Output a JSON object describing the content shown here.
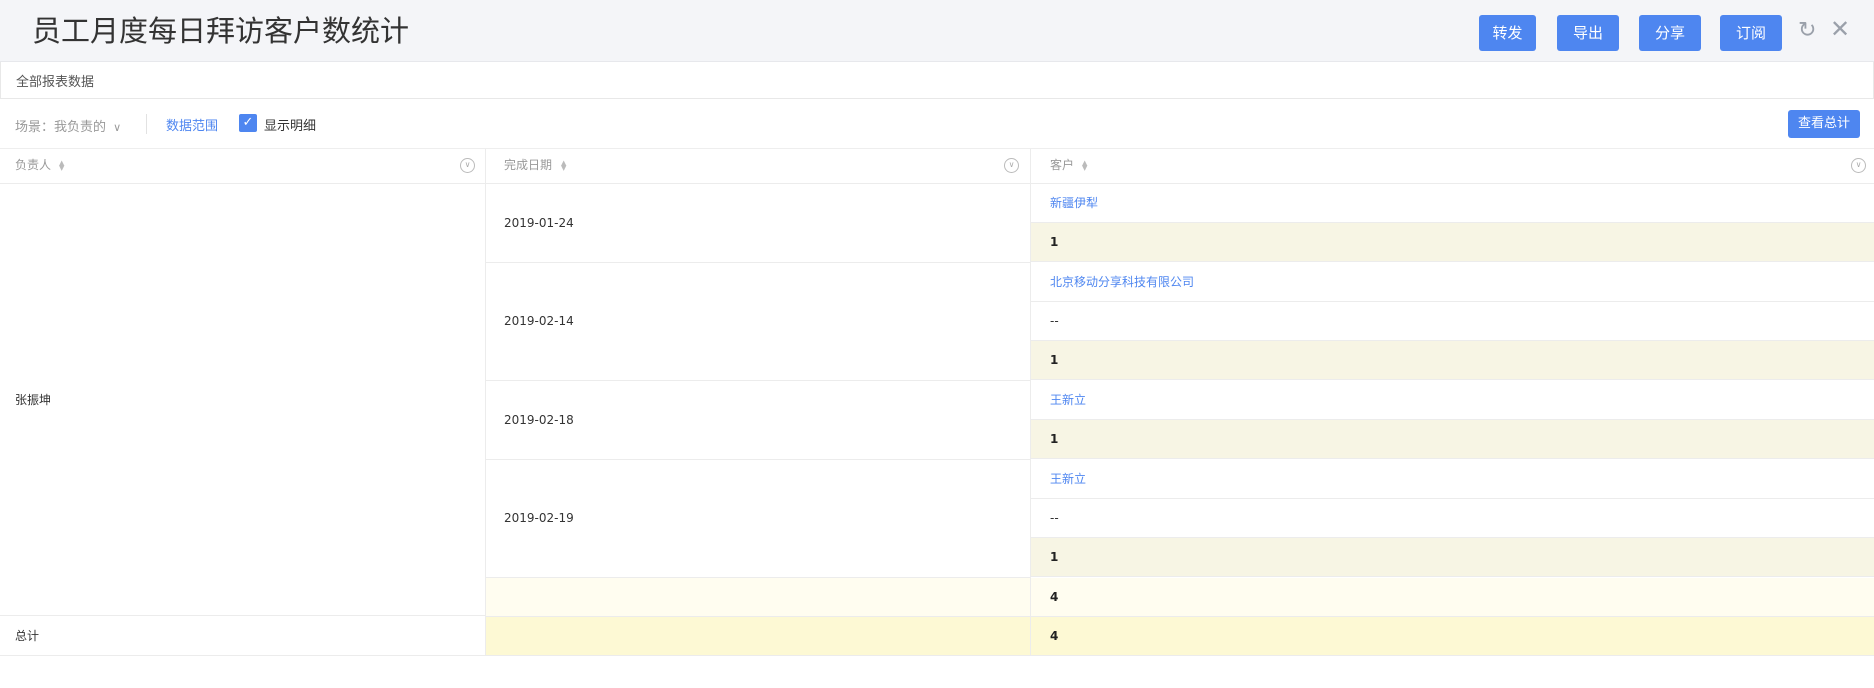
{
  "header": {
    "title": "员工月度每日拜访客户数统计",
    "buttons": [
      "转发",
      "导出",
      "分享",
      "订阅"
    ],
    "refresh_icon": "refresh-icon",
    "close_icon": "close-icon"
  },
  "subbar": {
    "label": "全部报表数据"
  },
  "filter": {
    "scene_label": "场景：我负责的",
    "data_range": "数据范围",
    "show_detail": "显示明细",
    "view_total": "查看总计"
  },
  "table": {
    "columns": [
      "负责人",
      "完成日期",
      "客户"
    ],
    "owner": "张振坤",
    "groups": [
      {
        "date": "2019-01-24",
        "rows": [
          {
            "text": "新疆伊犁",
            "type": "link"
          },
          {
            "text": "1",
            "type": "sub"
          }
        ]
      },
      {
        "date": "2019-02-14",
        "rows": [
          {
            "text": "北京移动分享科技有限公司",
            "type": "link"
          },
          {
            "text": "--",
            "type": "dash"
          },
          {
            "text": "1",
            "type": "sub"
          }
        ]
      },
      {
        "date": "2019-02-18",
        "rows": [
          {
            "text": "王新立",
            "type": "link"
          },
          {
            "text": "1",
            "type": "sub"
          }
        ]
      },
      {
        "date": "2019-02-19",
        "rows": [
          {
            "text": "王新立",
            "type": "link"
          },
          {
            "text": "--",
            "type": "dash"
          },
          {
            "text": "1",
            "type": "sub"
          }
        ]
      }
    ],
    "owner_subtotal": "4",
    "grand_total_label": "总计",
    "grand_total": "4"
  },
  "colors": {
    "accent": "#4e86f0",
    "subtotal_bg": "#f7f5e4",
    "total_bg": "#fdf9d4"
  }
}
